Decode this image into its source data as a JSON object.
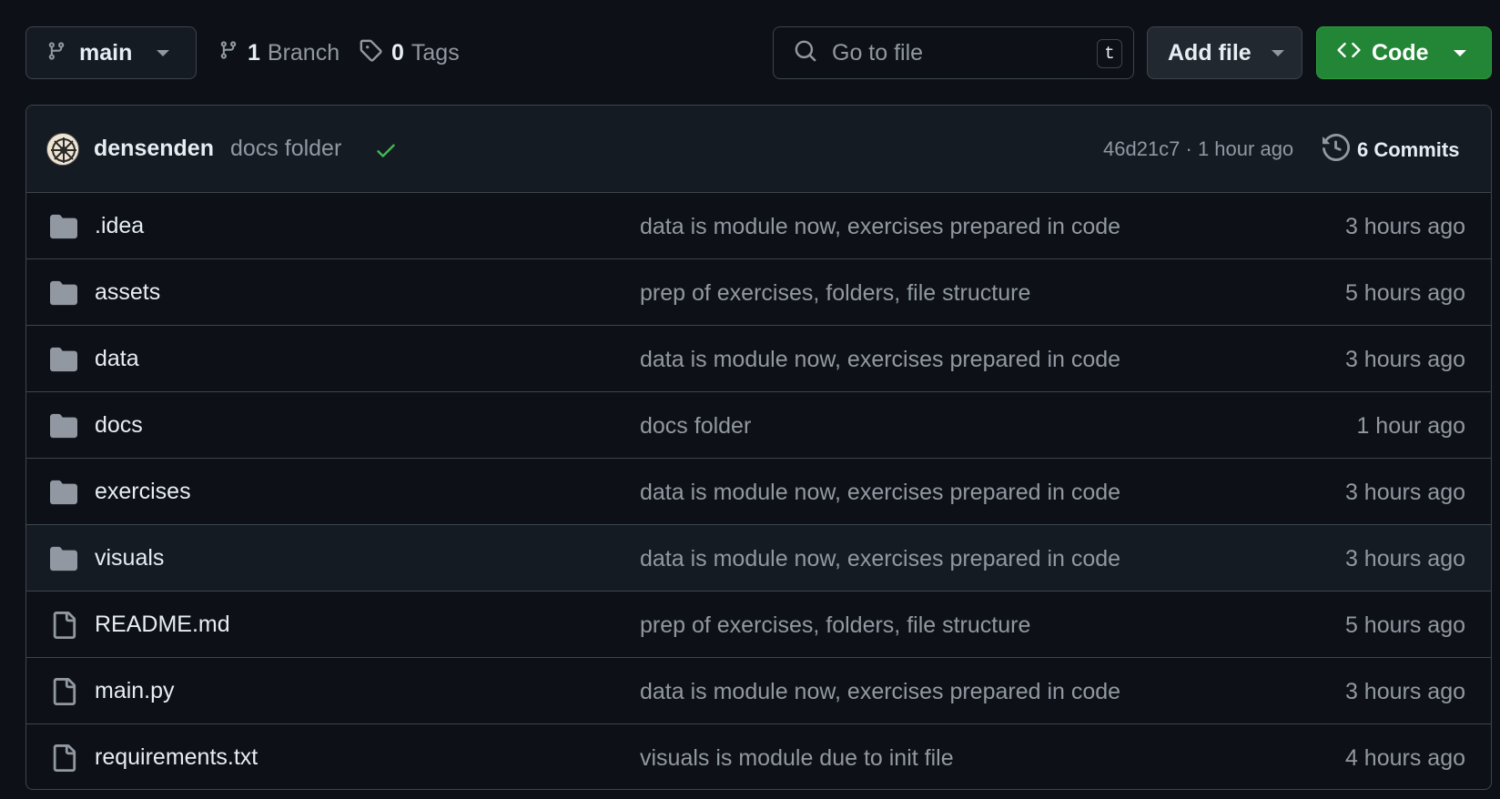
{
  "toolbar": {
    "branch_name": "main",
    "branches_count": "1",
    "branches_label": "Branch",
    "tags_count": "0",
    "tags_label": "Tags",
    "search_placeholder": "Go to file",
    "search_shortcut": "t",
    "add_file_label": "Add file",
    "code_label": "Code"
  },
  "latest_commit": {
    "author": "densenden",
    "message": "docs folder",
    "status": "success",
    "hash_and_time": "46d21c7 · 1 hour ago",
    "commits_label": "6 Commits"
  },
  "files": [
    {
      "name": ".idea",
      "type": "folder",
      "message": "data is module now, exercises prepared in code",
      "age": "3 hours ago"
    },
    {
      "name": "assets",
      "type": "folder",
      "message": "prep of exercises, folders, file structure",
      "age": "5 hours ago"
    },
    {
      "name": "data",
      "type": "folder",
      "message": "data is module now, exercises prepared in code",
      "age": "3 hours ago"
    },
    {
      "name": "docs",
      "type": "folder",
      "message": "docs folder",
      "age": "1 hour ago"
    },
    {
      "name": "exercises",
      "type": "folder",
      "message": "data is module now, exercises prepared in code",
      "age": "3 hours ago"
    },
    {
      "name": "visuals",
      "type": "folder",
      "message": "data is module now, exercises prepared in code",
      "age": "3 hours ago"
    },
    {
      "name": "README.md",
      "type": "file",
      "message": "prep of exercises, folders, file structure",
      "age": "5 hours ago"
    },
    {
      "name": "main.py",
      "type": "file",
      "message": "data is module now, exercises prepared in code",
      "age": "3 hours ago"
    },
    {
      "name": "requirements.txt",
      "type": "file",
      "message": "visuals is module due to init file",
      "age": "4 hours ago"
    }
  ],
  "colors": {
    "background": "#0d1117",
    "border": "#3d444d",
    "code_button": "#238636",
    "success_check": "#3fb950",
    "muted_text": "#9198a1",
    "folder_icon": "#9198a1"
  }
}
